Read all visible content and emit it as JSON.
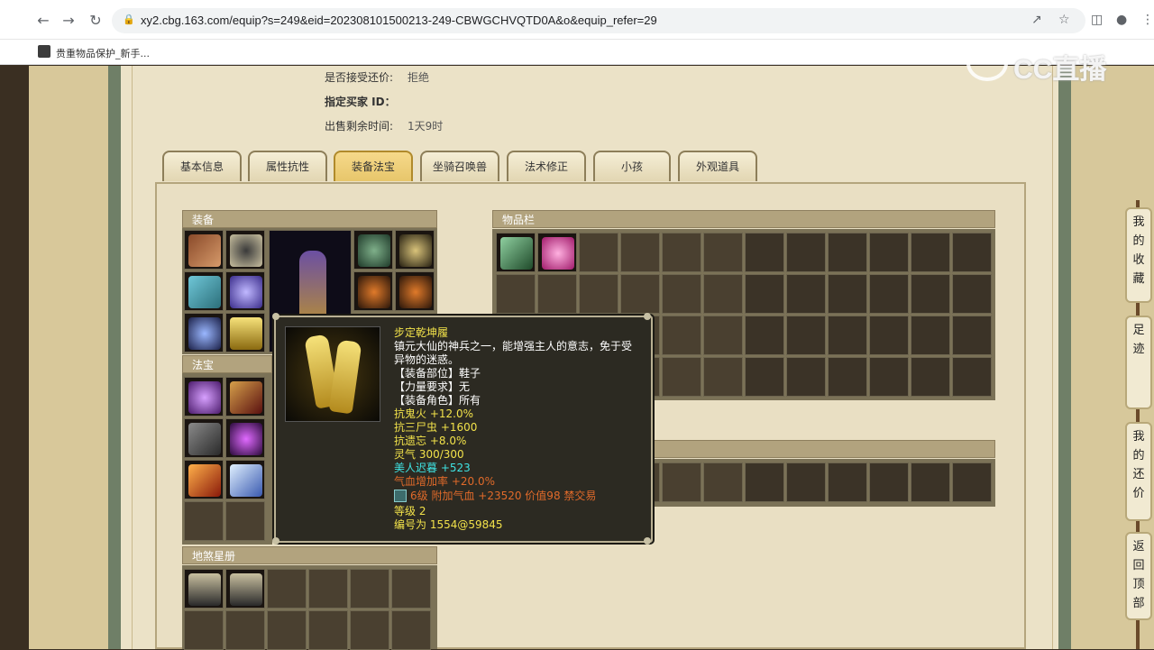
{
  "browser": {
    "url": "xy2.cbg.163.com/equip?s=249&eid=202308101500213-249-CBWGCHVQTD0A&o&equip_refer=29",
    "bookmark": "贵重物品保护_新手..."
  },
  "watermark": "CC直播",
  "info": {
    "counter_offer_label": "是否接受还价:",
    "counter_offer_value": "拒绝",
    "buyer_id_label": "指定买家 ID：",
    "buyer_id_value": "",
    "time_left_label": "出售剩余时间:",
    "time_left_value": "1天9时"
  },
  "tabs": [
    "基本信息",
    "属性抗性",
    "装备法宝",
    "坐骑召唤兽",
    "法术修正",
    "小孩",
    "外观道具"
  ],
  "active_tab": "装备法宝",
  "sections": {
    "equipment": "装备",
    "treasure": "法宝",
    "earth": "地煞星册",
    "inventory": "物品栏"
  },
  "tooltip": {
    "name": "步定乾坤履",
    "desc1": "镇元大仙的神兵之一，能增强主人的意志，免于受",
    "desc2": "异物的迷惑。",
    "slot": "【装备部位】鞋子",
    "strength": "【力量要求】无",
    "role": "【装备角色】所有",
    "attr1": "抗鬼火 +12.0%",
    "attr2": "抗三尸虫 +1600",
    "attr3": "抗遗忘 +8.0%",
    "spirit": "灵气 300/300",
    "beauty": "美人迟暮 +523",
    "hp_rate": "气血增加率 +20.0%",
    "gem": "6级 附加气血 +23520 价值98 禁交易",
    "level": "等级 2",
    "serial": "编号为 1554@59845"
  },
  "side_nav": {
    "favorites": "我的收藏",
    "history": "足迹",
    "offers": "我的还价",
    "top": "返回顶部"
  }
}
